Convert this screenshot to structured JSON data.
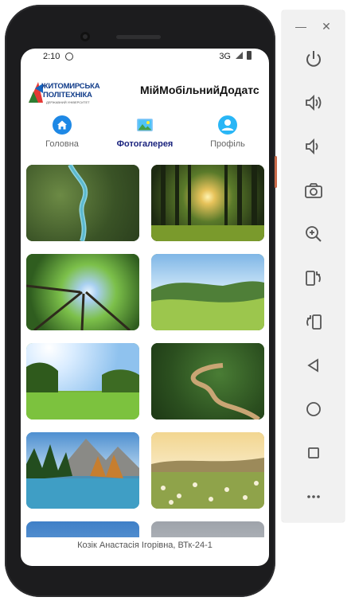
{
  "status_bar": {
    "time": "2:10",
    "network": "3G"
  },
  "header": {
    "logo_line1": "ЖИТОМИРСЬКА",
    "logo_line2": "ПОЛІТЕХНІКА",
    "logo_tagline": "ДЕРЖАВНИЙ УНІВЕРСИТЕТ",
    "app_title": "МійМобільнийДодатс"
  },
  "tabs": [
    {
      "label": "Головна",
      "icon": "home-icon",
      "active": false
    },
    {
      "label": "Фотогалерея",
      "icon": "gallery-icon",
      "active": true
    },
    {
      "label": "Профіль",
      "icon": "profile-icon",
      "active": false
    }
  ],
  "gallery": [
    {
      "subject": "aerial river through forest"
    },
    {
      "subject": "sun through tall pine trees"
    },
    {
      "subject": "looking up at tree canopy"
    },
    {
      "subject": "green meadow hills"
    },
    {
      "subject": "sunny green field with trees"
    },
    {
      "subject": "winding river in forest aerial"
    },
    {
      "subject": "mountain lake with reflection"
    },
    {
      "subject": "meadow of wild flowers at sunset"
    },
    {
      "subject": "blue sky landscape"
    },
    {
      "subject": "grey sky landscape"
    }
  ],
  "footer": {
    "text": "Козік Анастасія Ігорівна, ВТк-24-1"
  },
  "emulator_controls": {
    "window_buttons": [
      "minimize-icon",
      "close-icon"
    ],
    "buttons": [
      "power-icon",
      "volume-up-icon",
      "volume-down-icon",
      "camera-icon",
      "zoom-icon",
      "rotate-left-icon",
      "rotate-right-icon",
      "back-icon",
      "home-circle-icon",
      "overview-icon",
      "more-icon"
    ]
  },
  "colors": {
    "active_tab": "#1a237e",
    "accent_home": "#1e88e5",
    "profile": "#29b6f6"
  }
}
